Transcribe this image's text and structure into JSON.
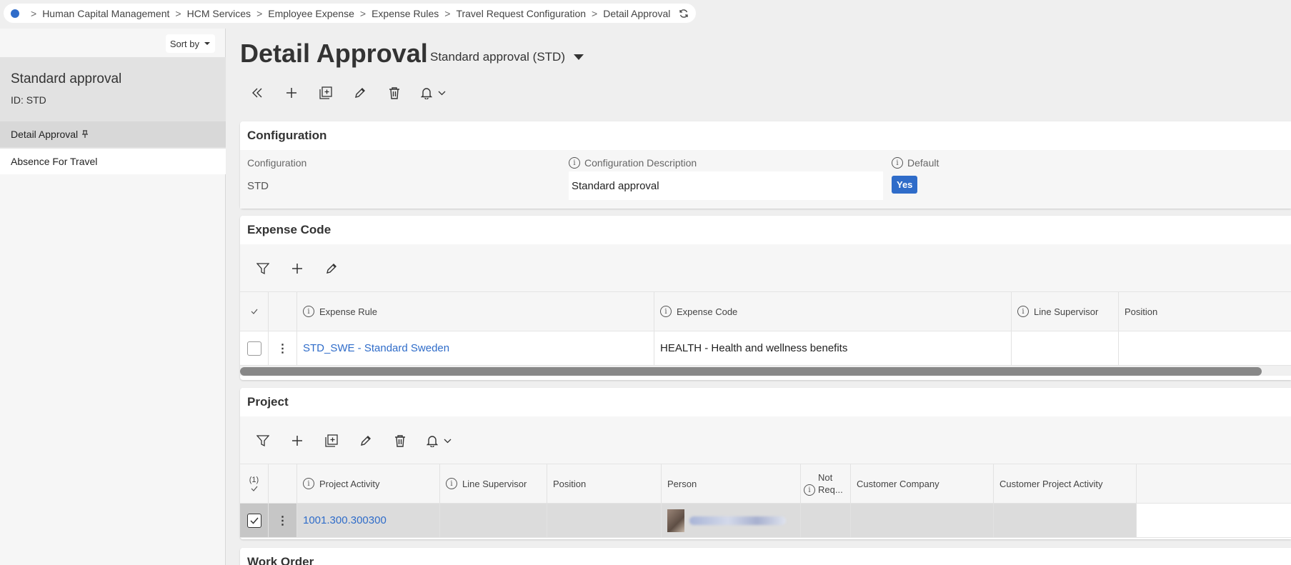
{
  "breadcrumb": {
    "items": [
      "Human Capital Management",
      "HCM Services",
      "Employee Expense",
      "Expense Rules",
      "Travel Request Configuration",
      "Detail Approval"
    ],
    "separator": ">"
  },
  "sidebar": {
    "sort_label": "Sort by",
    "record_title": "Standard approval",
    "record_id": "ID:   STD",
    "nav": [
      {
        "label": "Detail Approval"
      },
      {
        "label": "Absence For Travel"
      }
    ]
  },
  "page": {
    "title": "Detail Approval",
    "subtitle": "Standard approval (STD)"
  },
  "configuration": {
    "title": "Configuration",
    "col1_label": "Configuration",
    "col1_value": "STD",
    "col2_label": "Configuration Description",
    "col2_value": "Standard approval",
    "col3_label": "Default",
    "col3_value": "Yes"
  },
  "expense_code": {
    "title": "Expense Code",
    "columns": [
      "Expense Rule",
      "Expense Code",
      "Line Supervisor",
      "Position"
    ],
    "rows": [
      {
        "expense_rule": "STD_SWE - Standard Sweden",
        "expense_code": "HEALTH - Health and wellness benefits",
        "line_supervisor": "",
        "position": ""
      }
    ]
  },
  "project": {
    "title": "Project",
    "selected_count": "(1)",
    "columns": [
      "Project Activity",
      "Line Supervisor",
      "Position",
      "Person",
      "Not Req...",
      "Customer Company",
      "Customer Project Activity"
    ],
    "not_req_top": "Not",
    "not_req_bottom": "Req...",
    "rows": [
      {
        "project_activity": "1001.300.300300",
        "line_supervisor": "",
        "position": "",
        "person": "",
        "customer_company": "",
        "customer_project_activity": ""
      }
    ]
  },
  "work_order": {
    "title": "Work Order"
  },
  "colors": {
    "accent": "#2f6cc9",
    "link": "#2f6cc9"
  }
}
